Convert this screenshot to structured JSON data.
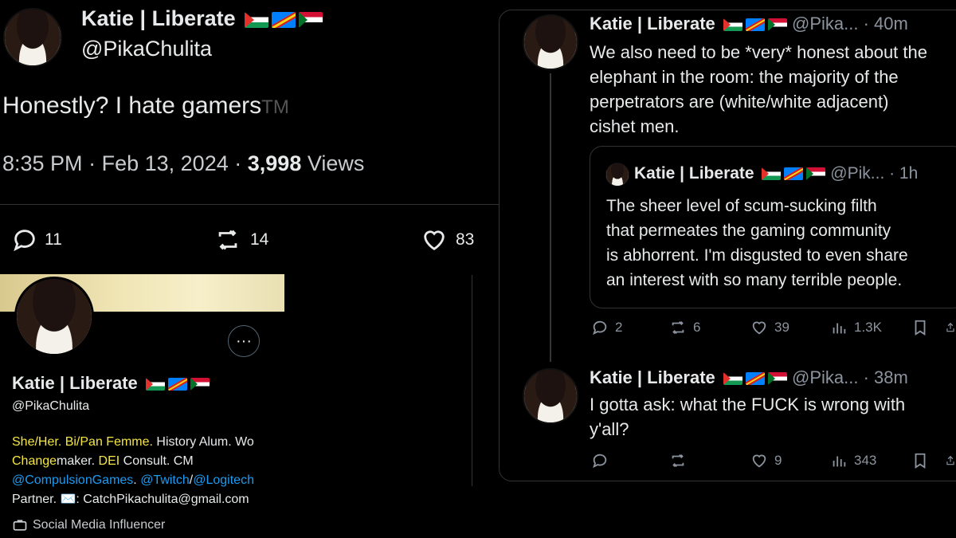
{
  "left_tweet": {
    "author_name": "Katie | Liberate",
    "handle": "@PikaChulita",
    "text": "Honestly? I hate gamers",
    "tm": "TM",
    "time": "8:35 PM",
    "sep1": "·",
    "date": "Feb 13, 2024",
    "sep2": "·",
    "views_count": "3,998",
    "views_label": "Views",
    "replies": "11",
    "retweets": "14",
    "likes": "83"
  },
  "profile": {
    "name": "Katie | Liberate",
    "handle": "@PikaChulita",
    "bio_line1_a": "She/Her. Bi/Pan Femme.",
    "bio_line1_b": " History Alum. Wo",
    "bio_line2_a": "Changemaker.",
    "bio_line2_a_cont": "Change",
    "bio_line2_a_rest": "maker.",
    "bio_line2_b": " DEI",
    "bio_line2_c": " Consult. CM",
    "bio_line3_a": "@CompulsionGames",
    "bio_line3_b": ". ",
    "bio_line3_c": "@Twitch",
    "bio_line3_d": "/",
    "bio_line3_e": "@Logitech",
    "bio_line4": "Partner. ✉️: CatchPikachulita@gmail.com",
    "category": "Social Media Influencer",
    "more": "···"
  },
  "reply1": {
    "author_name": "Katie | Liberate",
    "handle_time": "@Pika... · 40m",
    "text": "We also need to be *very* honest about the elephant in the room: the majority of the perpetrators are (white/white adjacent) cishet men.",
    "line1": "We also need to be *very* honest about the",
    "line2": "elephant in the room: the majority of the",
    "line3": "perpetrators are (white/white adjacent)",
    "line4": "cishet men."
  },
  "quoted": {
    "author_name": "Katie | Liberate",
    "handle_time": "@Pik... · 1h",
    "line1": "The sheer level of scum-sucking filth",
    "line2": "that permeates the gaming community",
    "line3": "is abhorrent. I'm disgusted to even share",
    "line4": "an interest with so many terrible people."
  },
  "reply1_actions": {
    "replies": "2",
    "retweets": "6",
    "likes": "39",
    "views": "1.3K"
  },
  "reply2": {
    "author_name": "Katie | Liberate",
    "handle_time": "@Pika... · 38m",
    "line1": "I gotta ask: what the FUCK is wrong with",
    "line2": "y'all?"
  },
  "reply2_actions": {
    "replies": "",
    "retweets": "",
    "likes": "9",
    "views": "343"
  },
  "colors": {
    "link": "#1d9bf0",
    "highlight": "#f5e642",
    "background": "#000000",
    "text": "#e7e9ea",
    "muted": "#8b949e"
  }
}
